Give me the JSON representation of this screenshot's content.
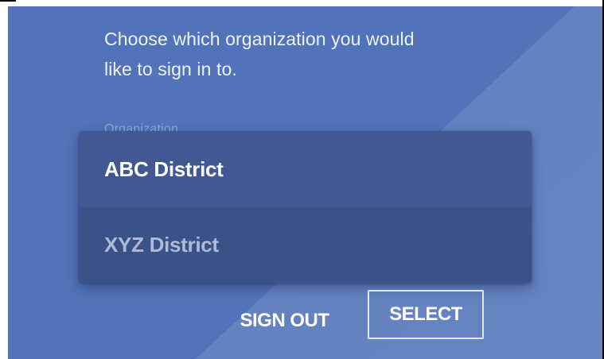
{
  "prompt": {
    "line1": "Choose which organization you would",
    "line2": "like to sign in to."
  },
  "organization_field": {
    "label": "Organization",
    "options": [
      {
        "label": "ABC District",
        "highlighted": true
      },
      {
        "label": "XYZ District",
        "highlighted": false
      }
    ]
  },
  "actions": {
    "sign_out_label": "SIGN OUT",
    "select_label": "SELECT"
  },
  "colors": {
    "background": "#5273b9",
    "dropdown_option_highlighted": "#415892",
    "dropdown_option": "#3b5288"
  }
}
